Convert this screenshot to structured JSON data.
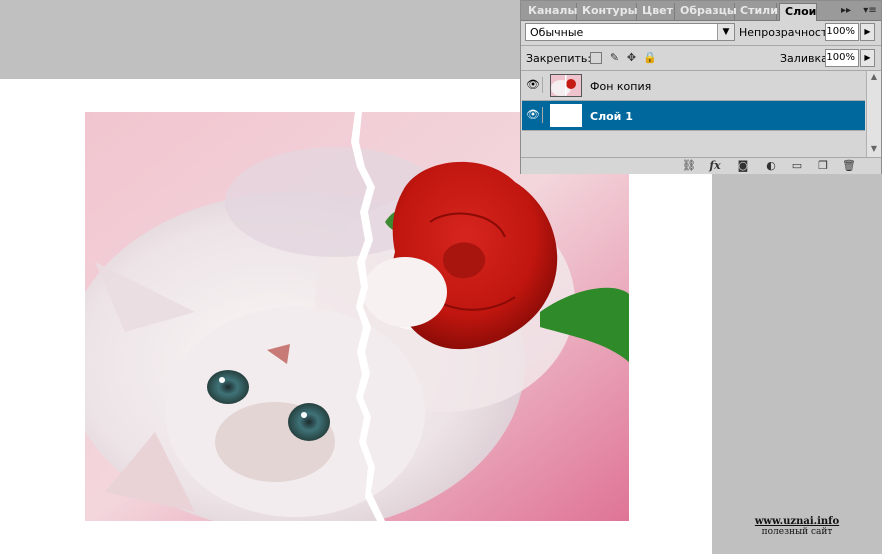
{
  "panel": {
    "tabs": [
      {
        "label": "Каналы"
      },
      {
        "label": "Контуры"
      },
      {
        "label": "Цвет"
      },
      {
        "label": "Образцы"
      },
      {
        "label": "Стили"
      },
      {
        "label": "Слои",
        "active": true
      }
    ],
    "menu_glyph": "▸▸",
    "options_glyph": "▾≡",
    "blend_mode": "Обычные",
    "opacity_label": "Непрозрачность:",
    "opacity_value": "100%",
    "lock_label": "Закрепить:",
    "fill_label": "Заливка:",
    "fill_value": "100%",
    "layers": [
      {
        "name": "Фон копия",
        "visible": true,
        "selected": false
      },
      {
        "name": "Слой 1",
        "visible": true,
        "selected": true
      }
    ],
    "footer_icons": [
      "link-icon",
      "fx-icon",
      "mask-icon",
      "adjustment-icon",
      "folder-icon",
      "new-layer-icon",
      "trash-icon"
    ]
  },
  "watermark": {
    "url": "www.uznai.info",
    "subtitle": "полезный сайт"
  },
  "colors": {
    "workspace": "#c0c0c0",
    "selection": "#00689c",
    "panel": "#d6d6d6"
  }
}
